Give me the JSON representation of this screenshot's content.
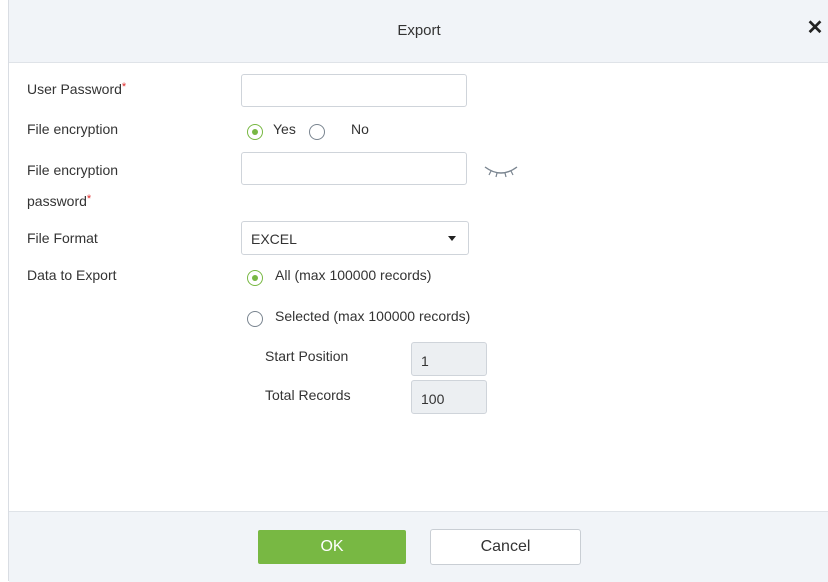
{
  "dialog": {
    "title": "Export",
    "close_icon": "close-icon",
    "close_glyph": "✕"
  },
  "form": {
    "user_password": {
      "label": "User Password",
      "required_mark": "*",
      "value": ""
    },
    "file_encryption": {
      "label": "File encryption",
      "yes_label": "Yes",
      "no_label": "No",
      "selected": "Yes"
    },
    "file_encryption_password": {
      "label_line1": "File encryption",
      "label_line2": "password",
      "required_mark": "*",
      "value": "",
      "toggle_icon": "eye-closed-icon"
    },
    "file_format": {
      "label": "File Format",
      "selected": "EXCEL"
    },
    "data_to_export": {
      "label": "Data to Export",
      "option_all": "All (max 100000 records)",
      "option_selected": "Selected (max 100000 records)",
      "selected": "All (max 100000 records)",
      "start_position_label": "Start Position",
      "start_position_value": "1",
      "total_records_label": "Total Records",
      "total_records_value": "100"
    }
  },
  "footer": {
    "ok_label": "OK",
    "cancel_label": "Cancel"
  },
  "colors": {
    "accent": "#78b843",
    "header_bg": "#f1f4f8",
    "required": "#e02828"
  }
}
